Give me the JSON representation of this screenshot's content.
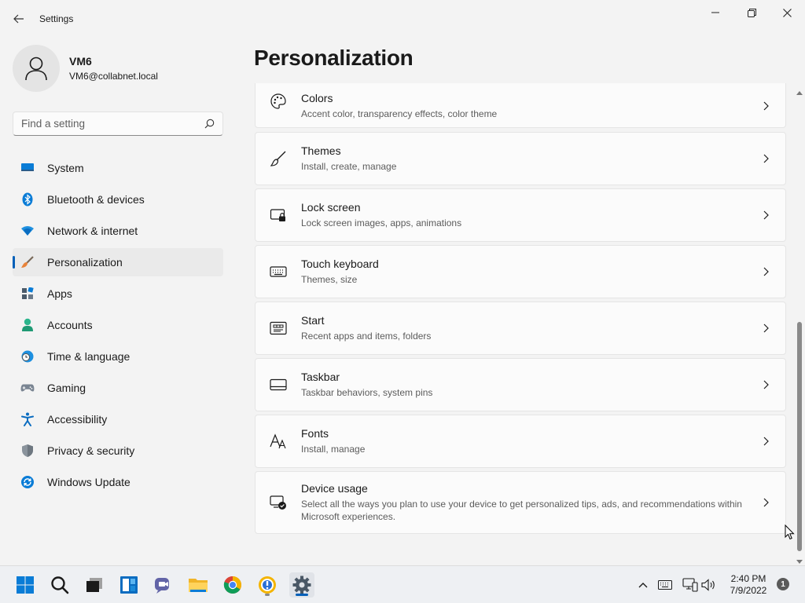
{
  "window": {
    "app_title": "Settings",
    "back_icon": "back-arrow-icon",
    "controls": [
      "minimize-icon",
      "maximize-icon",
      "close-icon"
    ]
  },
  "profile": {
    "name": "VM6",
    "email": "VM6@collabnet.local",
    "avatar_icon": "user-icon"
  },
  "search": {
    "placeholder": "Find a setting",
    "icon": "search-icon"
  },
  "sidebar": {
    "active_index": 3,
    "accent": "#005fb8",
    "items": [
      {
        "label": "System",
        "icon": "system-icon"
      },
      {
        "label": "Bluetooth & devices",
        "icon": "bluetooth-icon"
      },
      {
        "label": "Network & internet",
        "icon": "wifi-icon"
      },
      {
        "label": "Personalization",
        "icon": "brush-icon"
      },
      {
        "label": "Apps",
        "icon": "apps-icon"
      },
      {
        "label": "Accounts",
        "icon": "accounts-icon"
      },
      {
        "label": "Time & language",
        "icon": "clock-globe-icon"
      },
      {
        "label": "Gaming",
        "icon": "gamepad-icon"
      },
      {
        "label": "Accessibility",
        "icon": "accessibility-icon"
      },
      {
        "label": "Privacy & security",
        "icon": "shield-icon"
      },
      {
        "label": "Windows Update",
        "icon": "update-icon"
      }
    ]
  },
  "main": {
    "title": "Personalization",
    "cards": [
      {
        "title": "Colors",
        "subtitle": "Accent color, transparency effects, color theme",
        "icon": "palette-icon"
      },
      {
        "title": "Themes",
        "subtitle": "Install, create, manage",
        "icon": "brush-icon"
      },
      {
        "title": "Lock screen",
        "subtitle": "Lock screen images, apps, animations",
        "icon": "lock-screen-icon"
      },
      {
        "title": "Touch keyboard",
        "subtitle": "Themes, size",
        "icon": "keyboard-icon"
      },
      {
        "title": "Start",
        "subtitle": "Recent apps and items, folders",
        "icon": "start-icon"
      },
      {
        "title": "Taskbar",
        "subtitle": "Taskbar behaviors, system pins",
        "icon": "taskbar-icon"
      },
      {
        "title": "Fonts",
        "subtitle": "Install, manage",
        "icon": "fonts-icon"
      },
      {
        "title": "Device usage",
        "subtitle": "Select all the ways you plan to use your device to get personalized tips, ads, and recommendations within Microsoft experiences.",
        "icon": "device-usage-icon"
      }
    ]
  },
  "taskbar": {
    "apps": [
      "windows-start-icon",
      "search-icon",
      "task-view-icon",
      "widgets-icon",
      "teams-chat-icon",
      "file-explorer-icon",
      "chrome-icon",
      "app-icon",
      "settings-gear-icon"
    ],
    "tray": [
      "chevron-up-icon",
      "keyboard-layout-icon",
      "network-icon",
      "volume-icon"
    ],
    "time": "2:40 PM",
    "date": "7/9/2022",
    "notification_count": "1"
  }
}
